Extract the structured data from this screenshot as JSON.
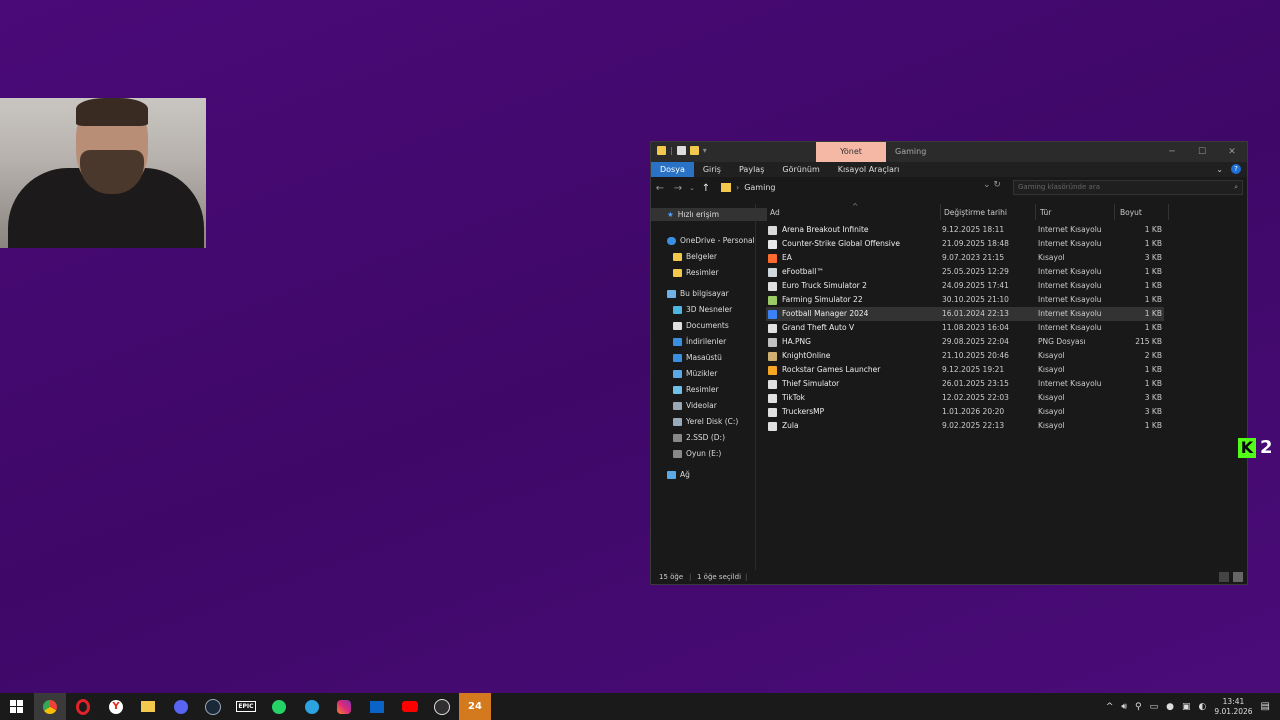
{
  "window": {
    "context_tab": "Yönet",
    "title": "Gaming",
    "ribbon_tabs": [
      "Dosya",
      "Giriş",
      "Paylaş",
      "Görünüm",
      "Kısayol Araçları"
    ],
    "address_folder": "Gaming",
    "search_placeholder": "Gaming klasöründe ara",
    "columns": {
      "name": "Ad",
      "date": "Değiştirme tarihi",
      "type": "Tür",
      "size": "Boyut"
    },
    "status_count": "15 öğe",
    "status_selected": "1 öğe seçildi"
  },
  "nav": {
    "quick_access": "Hızlı erişim",
    "onedrive": "OneDrive - Personal",
    "od_docs": "Belgeler",
    "od_pics": "Resimler",
    "this_pc": "Bu bilgisayar",
    "objects3d": "3D Nesneler",
    "documents": "Documents",
    "downloads": "İndirilenler",
    "desktop": "Masaüstü",
    "music": "Müzikler",
    "pictures": "Resimler",
    "videos": "Videolar",
    "disk_c": "Yerel Disk (C:)",
    "disk_d": "2.SSD (D:)",
    "disk_e": "Oyun (E:)",
    "network": "Ağ"
  },
  "files": [
    {
      "name": "Arena Breakout Infinite",
      "date": "9.12.2025 18:11",
      "type": "Internet Kısayolu",
      "size": "1 KB"
    },
    {
      "name": "Counter-Strike Global Offensive",
      "date": "21.09.2025 18:48",
      "type": "Internet Kısayolu",
      "size": "1 KB"
    },
    {
      "name": "EA",
      "date": "9.07.2023 21:15",
      "type": "Kısayol",
      "size": "3 KB"
    },
    {
      "name": "eFootball™",
      "date": "25.05.2025 12:29",
      "type": "Internet Kısayolu",
      "size": "1 KB"
    },
    {
      "name": "Euro Truck Simulator 2",
      "date": "24.09.2025 17:41",
      "type": "Internet Kısayolu",
      "size": "1 KB"
    },
    {
      "name": "Farming Simulator 22",
      "date": "30.10.2025 21:10",
      "type": "Internet Kısayolu",
      "size": "1 KB"
    },
    {
      "name": "Football Manager 2024",
      "date": "16.01.2024 22:13",
      "type": "Internet Kısayolu",
      "size": "1 KB"
    },
    {
      "name": "Grand Theft Auto V",
      "date": "11.08.2023 16:04",
      "type": "Internet Kısayolu",
      "size": "1 KB"
    },
    {
      "name": "HA.PNG",
      "date": "29.08.2025 22:04",
      "type": "PNG Dosyası",
      "size": "215 KB"
    },
    {
      "name": "KnightOnline",
      "date": "21.10.2025 20:46",
      "type": "Kısayol",
      "size": "2 KB"
    },
    {
      "name": "Rockstar Games Launcher",
      "date": "9.12.2025 19:21",
      "type": "Kısayol",
      "size": "1 KB"
    },
    {
      "name": "Thief Simulator",
      "date": "26.01.2025 23:15",
      "type": "Internet Kısayolu",
      "size": "1 KB"
    },
    {
      "name": "TikTok",
      "date": "12.02.2025 22:03",
      "type": "Kısayol",
      "size": "3 KB"
    },
    {
      "name": "TruckersMP",
      "date": "1.01.2026 20:20",
      "type": "Kısayol",
      "size": "3 KB"
    },
    {
      "name": "Zula",
      "date": "9.02.2025 22:13",
      "type": "Kısayol",
      "size": "1 KB"
    }
  ],
  "overlay": {
    "kick_letter": "K",
    "number": "2"
  },
  "taskbar": {
    "epic_label": "EPIC",
    "badge_24": "24"
  },
  "clock": {
    "time": "13:41",
    "date": "9.01.2026"
  }
}
